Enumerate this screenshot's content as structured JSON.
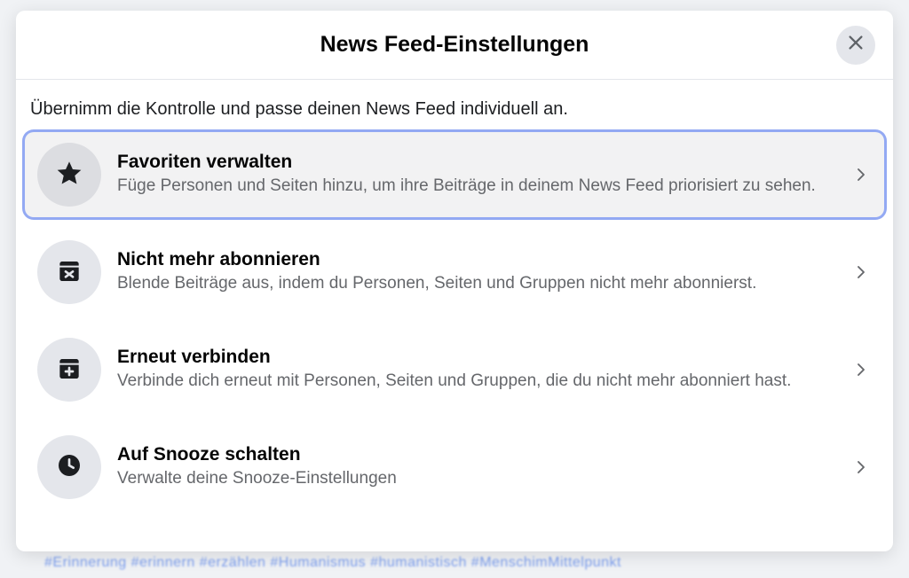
{
  "backdrop_hashtags": "#Erinnerung #erinnern #erzählen #Humanismus #humanistisch #MenschimMittelpunkt",
  "modal": {
    "title": "News Feed-Einstellungen",
    "intro": "Übernimm die Kontrolle und passe deinen News Feed individuell an.",
    "options": [
      {
        "icon": "star-icon",
        "title": "Favoriten verwalten",
        "desc": "Füge Personen und Seiten hinzu, um ihre Beiträge in deinem News Feed priorisiert zu sehen.",
        "selected": true
      },
      {
        "icon": "unfollow-box-icon",
        "title": "Nicht mehr abonnieren",
        "desc": "Blende Beiträge aus, indem du Personen, Seiten und Gruppen nicht mehr abonnierst.",
        "selected": false
      },
      {
        "icon": "reconnect-box-icon",
        "title": "Erneut verbinden",
        "desc": "Verbinde dich erneut mit Personen, Seiten und Gruppen, die du nicht mehr abonniert hast.",
        "selected": false
      },
      {
        "icon": "clock-icon",
        "title": "Auf Snooze schalten",
        "desc": "Verwalte deine Snooze-Einstellungen",
        "selected": false
      }
    ]
  }
}
